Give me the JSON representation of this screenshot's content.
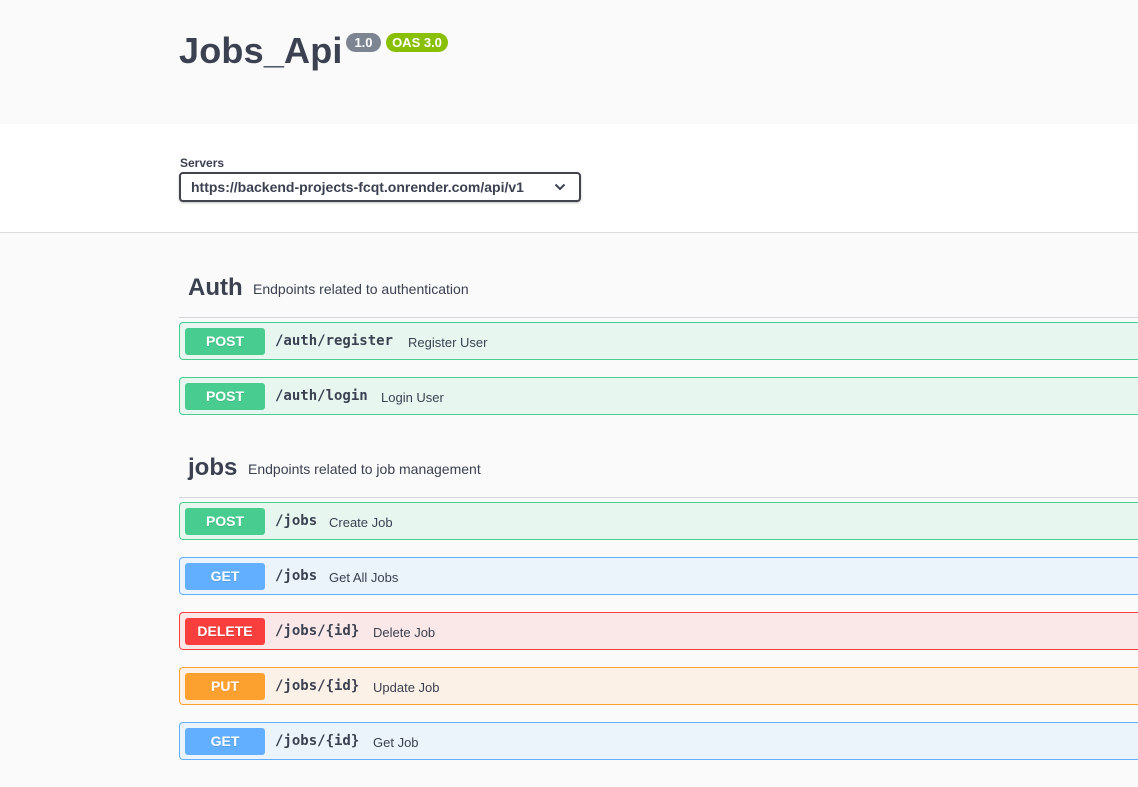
{
  "info": {
    "title": "Jobs_Api",
    "version": "1.0",
    "oas": "OAS 3.0"
  },
  "servers": {
    "label": "Servers",
    "selected": "https://backend-projects-fcqt.onrender.com/api/v1"
  },
  "tags": [
    {
      "name": "Auth",
      "description": "Endpoints related to authentication",
      "operations": [
        {
          "method": "POST",
          "path": "/auth/register",
          "summary": "Register User"
        },
        {
          "method": "POST",
          "path": "/auth/login",
          "summary": "Login User"
        }
      ]
    },
    {
      "name": "jobs",
      "description": "Endpoints related to job management",
      "operations": [
        {
          "method": "POST",
          "path": "/jobs",
          "summary": "Create Job"
        },
        {
          "method": "GET",
          "path": "/jobs",
          "summary": "Get All Jobs"
        },
        {
          "method": "DELETE",
          "path": "/jobs/{id}",
          "summary": "Delete Job"
        },
        {
          "method": "PUT",
          "path": "/jobs/{id}",
          "summary": "Update Job"
        },
        {
          "method": "GET",
          "path": "/jobs/{id}",
          "summary": "Get Job"
        }
      ]
    }
  ],
  "colors": {
    "post": "#49cc90",
    "get": "#61affe",
    "delete": "#f93e3e",
    "put": "#fca130",
    "version_badge": "#7d8492",
    "oas_badge": "#89bf04"
  }
}
